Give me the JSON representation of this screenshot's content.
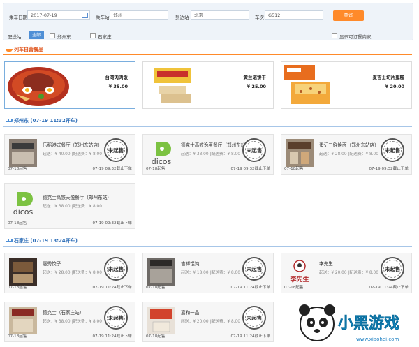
{
  "search": {
    "date_label": "乘车日期",
    "date_value": "2017-07-19",
    "from_label": "乘车站",
    "from_value": "郑州",
    "to_label": "到达站",
    "to_value": "北京",
    "train_label": "车次",
    "train_value": "G512",
    "query_label": "查询",
    "station_label": "配送站:",
    "station_all": "全部",
    "station_1": "郑州东",
    "station_2": "石家庄",
    "show_orderable": "显示可订餐商家"
  },
  "food_section": {
    "title": "列车自营餐品"
  },
  "foods": [
    {
      "name": "台湾肉肉饭",
      "price": "¥ 35.00"
    },
    {
      "name": "黄兰诺饼干",
      "price": "¥ 25.00"
    },
    {
      "name": "麦吉士切片蛋糕",
      "price": "¥ 20.00"
    }
  ],
  "section_zz": {
    "title": "郑州东 (07-19 11:32开车)"
  },
  "section_sjz": {
    "title": "石家庄 (07-19 13:24开车)"
  },
  "stamp_text": "未起售",
  "restaurants_zz": [
    {
      "name": "乐稻港式餐厅（郑州东站店）",
      "fee": "起送：¥ 40.00 |配送费：¥ 8.00",
      "date": "07-18起售",
      "deadline": "07-19 09:32截止下单"
    },
    {
      "name": "德克士高铁逸臣餐厅（郑州东站店）",
      "fee": "起送：¥ 38.00 |配送费：¥ 8.00",
      "date": "07-18起售",
      "deadline": "07-19 09:32截止下单"
    },
    {
      "name": "蛋记三鲜烩面（郑州东站店）",
      "fee": "起送：¥ 28.00 |配送费：¥ 8.00",
      "date": "07-18起售",
      "deadline": "07-19 09:32截止下单"
    },
    {
      "name": "德克士高铁天悦餐厅（郑州东站）",
      "fee": "起送：¥ 38.00 |配送费：¥ 8.00",
      "date": "07-18起售",
      "deadline": "07-19 09:32截止下单"
    }
  ],
  "restaurants_sjz": [
    {
      "name": "惠秀饺子",
      "fee": "起送：¥ 28.00 |配送费：¥ 8.00",
      "date": "07-18起售",
      "deadline": "07-19 11:24截止下单"
    },
    {
      "name": "吉祥馄饨",
      "fee": "起送：¥ 18.00 |配送费：¥ 8.00",
      "date": "07-18起售",
      "deadline": "07-19 11:24截止下单"
    },
    {
      "name": "李先生",
      "fee": "起送：¥ 20.00 |配送费：¥ 8.00",
      "date": "07-18起售",
      "deadline": "07-19 11:24截止下单"
    },
    {
      "name": "德克士（石家庄站）",
      "fee": "起送：¥ 38.00 |配送费：¥ 8.00",
      "date": "07-18起售",
      "deadline": "07-19 11:24截止下单"
    },
    {
      "name": "嘉和一品",
      "fee": "起送：¥ 20.00 |配送费：¥ 8.00",
      "date": "07-18起售",
      "deadline": "07-19 11:24截止下单"
    }
  ],
  "logo": {
    "dicos": "dicos",
    "lixiansheng": "李先生",
    "watermark_text": "小黑游戏",
    "watermark_url": "www.xiaohei.com"
  },
  "colors": {
    "accent_orange": "#ff8a2a",
    "accent_blue": "#4f8fd6",
    "section_line": "#a7c6e8"
  }
}
